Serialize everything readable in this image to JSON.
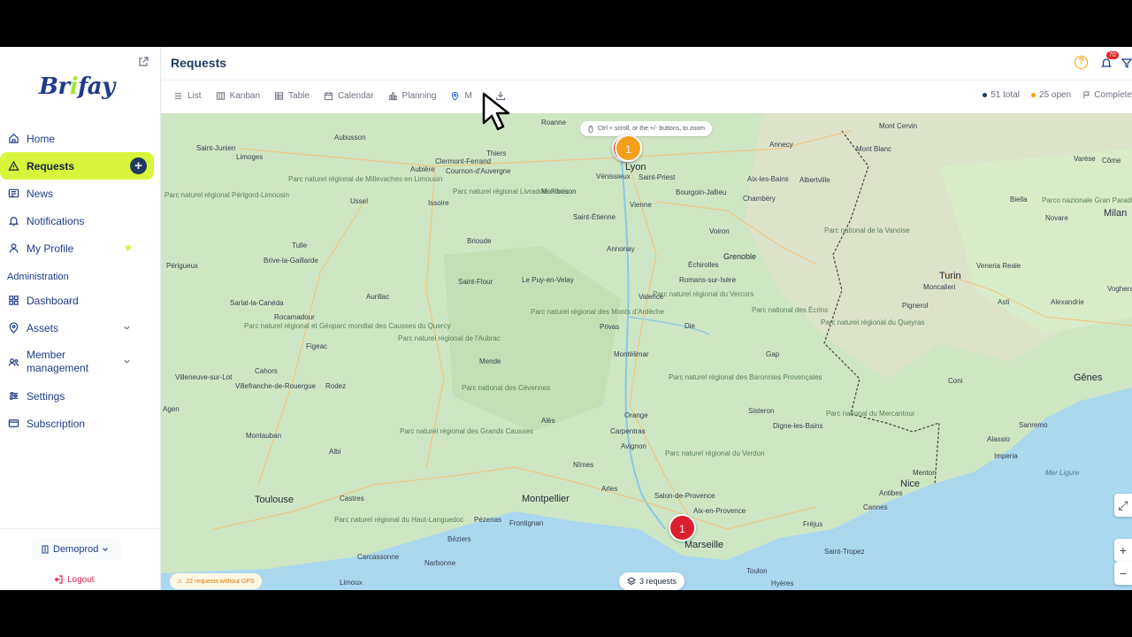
{
  "sidebar": {
    "logo": "Brifay",
    "items": [
      {
        "label": "Home"
      },
      {
        "label": "Requests"
      },
      {
        "label": "News"
      },
      {
        "label": "Notifications"
      },
      {
        "label": "My Profile"
      }
    ],
    "admin_section": "Administration",
    "admin_items": [
      {
        "label": "Dashboard"
      },
      {
        "label": "Assets"
      },
      {
        "label": "Member management"
      },
      {
        "label": "Settings"
      },
      {
        "label": "Subscription"
      }
    ],
    "workspace": "Demoprod",
    "logout": "Logout"
  },
  "header": {
    "title": "Requests",
    "notification_count": "70"
  },
  "views": [
    {
      "label": "List"
    },
    {
      "label": "Kanban"
    },
    {
      "label": "Table"
    },
    {
      "label": "Calendar"
    },
    {
      "label": "Planning"
    },
    {
      "label": "M"
    }
  ],
  "stats": {
    "total": "51 total",
    "open": "25 open",
    "completed": "Complete",
    "total_color": "#1e3a5f",
    "open_color": "#f59e0b"
  },
  "map": {
    "zoom_hint": "Ctrl + scroll, or the +/- buttons, to zoom",
    "no_gps": "22 requests without GPS",
    "request_count": "3 requests",
    "markers": [
      {
        "count": "1",
        "color": "orange"
      },
      {
        "count": "1",
        "color": "red"
      }
    ],
    "cities_big": [
      "Lyon",
      "Grenoble",
      "Turin",
      "Marseille",
      "Montpellier",
      "Toulouse",
      "Nice",
      "Gênes",
      "Milan"
    ],
    "cities": [
      "Aubusson",
      "Limoges",
      "Clermont-Ferrand",
      "Thiers",
      "Roanne",
      "Annecy",
      "Mont Cervin",
      "Mont Blanc",
      "Varèse",
      "Côme",
      "Saint-Junien",
      "Aubière",
      "Cournon-d'Auvergne",
      "Vénissieux",
      "Saint-Priest",
      "Bourgoin-Jallieu",
      "Aix-les-Bains",
      "Albertville",
      "Biella",
      "Montbrison",
      "Chambéry",
      "Novare",
      "Ussel",
      "Issoire",
      "Saint-Étienne",
      "Vienne",
      "Tulle",
      "Brioude",
      "Voiron",
      "Périgueux",
      "Brive-la-Gaillarde",
      "Annonay",
      "Échirolles",
      "Veneria Reale",
      "Saint-Flour",
      "Le Puy-en-Velay",
      "Romans-sur-Isère",
      "Moncalieri",
      "Aurillac",
      "Valence",
      "Asti",
      "Alexandrie",
      "Sarlat-la-Canéda",
      "Pignerol",
      "Voghera",
      "Rocamadour",
      "Privas",
      "Die",
      "Figeac",
      "Mende",
      "Montélimar",
      "Gap",
      "Cahors",
      "Coni",
      "Villeneuve-sur-Lot",
      "Villefranche-de-Rouergue",
      "Rodez",
      "Orange",
      "Sisteron",
      "Agen",
      "Alès",
      "Digne-les-Bains",
      "Montauban",
      "Carpentras",
      "Albi",
      "Avignon",
      "Sanremo",
      "Alassio",
      "Imperia",
      "Menton",
      "Nîmes",
      "Castres",
      "Arles",
      "Salon-de-Provence",
      "Aix-en-Provence",
      "Cannes",
      "Antibes",
      "Fréjus",
      "Pézenas",
      "Frontignan",
      "Béziers",
      "Carcassonne",
      "Narbonne",
      "Toulon",
      "Hyères",
      "Saint-Tropez",
      "Limoux"
    ],
    "parks": [
      "Parc naturel régional de Millevaches en Limousin",
      "Parc naturel régional Périgord-Limousin",
      "Parc naturel régional Livradois-Forez",
      "Parc national de la Vanoise",
      "Parco nazionale Gran Paradiso",
      "Parc naturel régional du Vercors",
      "Parc national des Écrins",
      "Parc naturel régional des Monts d'Ardèche",
      "Parc naturel régional du Queyras",
      "Parc naturel régional et Géoparc mondial des Causses du Quercy",
      "Parc naturel régional de l'Aubrac",
      "Parc national des Cévennes",
      "Parc naturel régional des Baronnies Provençales",
      "Parc national du Mercantour",
      "Parc naturel régional des Grands Causses",
      "Parc naturel régional du Verdon",
      "Parc naturel régional du Haut-Languedoc"
    ],
    "sea_label": "Mer Ligure"
  }
}
